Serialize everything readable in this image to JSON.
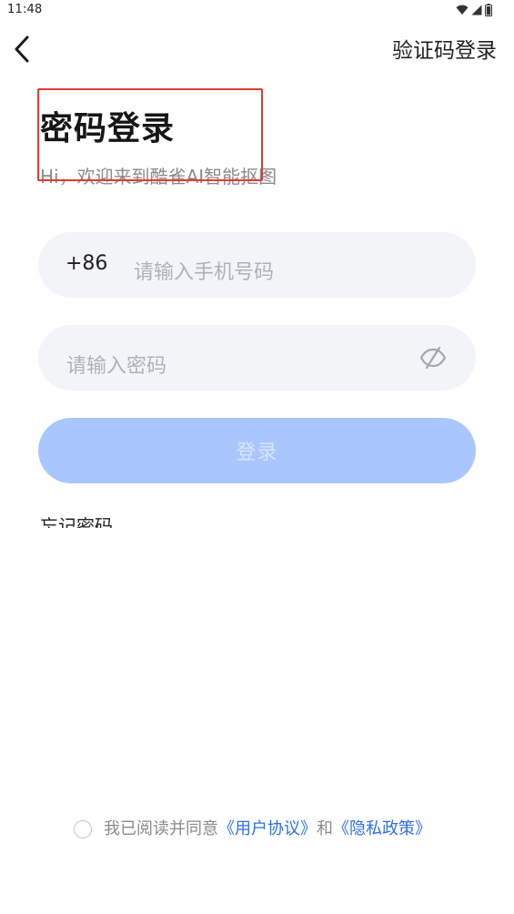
{
  "status_bar": {
    "time": "11:48",
    "icons": [
      "wifi-icon",
      "signal-icon",
      "battery-icon"
    ]
  },
  "header": {
    "back_icon": "chevron-left-icon",
    "switch_login_label": "验证码登录"
  },
  "intro": {
    "title": "密码登录",
    "subtitle": "Hi，欢迎来到酷雀AI智能抠图"
  },
  "phone_field": {
    "country_code": "+86",
    "placeholder": "请输入手机号码",
    "value": ""
  },
  "password_field": {
    "placeholder": "请输入密码",
    "value": "",
    "toggle_icon": "eye-off-icon"
  },
  "login_button": {
    "label": "登录"
  },
  "forgot_password": {
    "label": "忘记密码"
  },
  "agreement": {
    "prefix": "我已阅读并同意",
    "user_agreement": "《用户协议》",
    "conjunction": "和",
    "privacy_policy": "《隐私政策》",
    "checked": false
  },
  "colors": {
    "primary_disabled": "#a9c7fe",
    "link": "#2f6fe8",
    "field_bg": "#f3f4f8",
    "highlight_border": "#e23b30"
  }
}
